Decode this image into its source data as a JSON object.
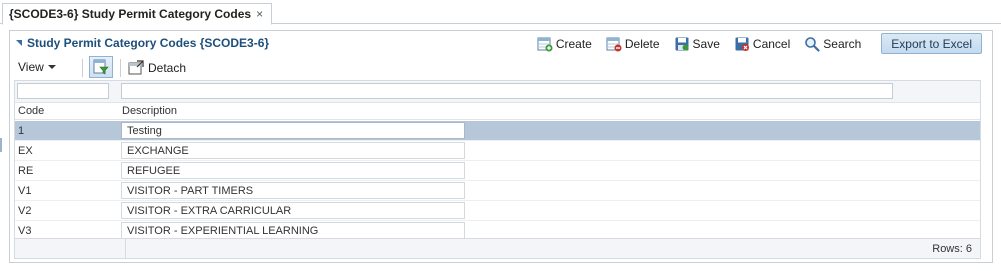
{
  "tab": {
    "label": "{SCODE3-6} Study Permit Category Codes",
    "close": "×"
  },
  "panel": {
    "title": "Study Permit Category Codes {SCODE3-6}",
    "actions": {
      "create": "Create",
      "delete": "Delete",
      "save": "Save",
      "cancel": "Cancel",
      "search": "Search",
      "export": "Export to Excel"
    }
  },
  "toolbar": {
    "view": "View",
    "detach": "Detach"
  },
  "grid": {
    "columns": {
      "code": "Code",
      "description": "Description"
    },
    "rows": [
      {
        "code": "1",
        "description": "Testing"
      },
      {
        "code": "EX",
        "description": "EXCHANGE"
      },
      {
        "code": "RE",
        "description": "REFUGEE"
      },
      {
        "code": "V1",
        "description": "VISITOR - PART TIMERS"
      },
      {
        "code": "V2",
        "description": "VISITOR - EXTRA CARRICULAR"
      },
      {
        "code": "V3",
        "description": "VISITOR - EXPERIENTIAL LEARNING"
      }
    ],
    "rows_count": "Rows: 6"
  },
  "colors": {
    "accent": "#1d4f7c",
    "selected_row": "#b6c7d9",
    "button_border": "#8fb3d2"
  }
}
